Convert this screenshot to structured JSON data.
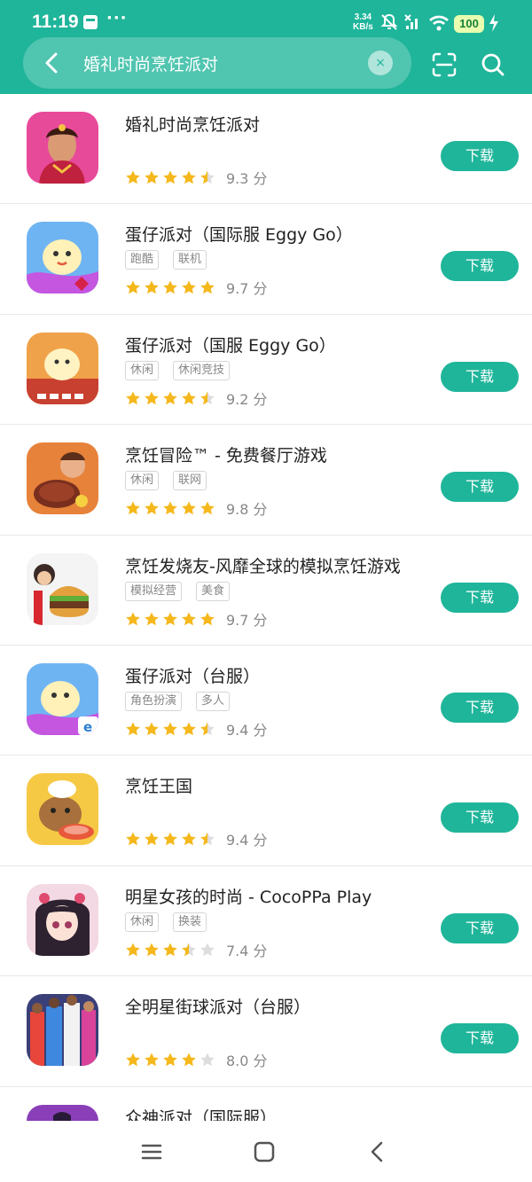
{
  "status_bar": {
    "time": "11:19",
    "net_speed_value": "3.34",
    "net_speed_unit": "KB/s",
    "battery": "100",
    "more": "···"
  },
  "search": {
    "query": "婚礼时尚烹饪派对",
    "clear_symbol": "×"
  },
  "colors": {
    "accent": "#1fb59a",
    "star": "#f5b81c",
    "star_empty": "#dddddd"
  },
  "apps": [
    {
      "name": "婚礼时尚烹饪派对",
      "tags": [],
      "stars": 4.5,
      "score": "9.3 分",
      "button": "下载",
      "icon": "bride-portrait-icon"
    },
    {
      "name": "蛋仔派对（国际服 Eggy Go）",
      "tags": [
        "跑酷",
        "联机"
      ],
      "stars": 5,
      "score": "9.7 分",
      "button": "下载",
      "icon": "eggy-party-icon"
    },
    {
      "name": "蛋仔派对（国服 Eggy Go）",
      "tags": [
        "休闲",
        "休闲竞技"
      ],
      "stars": 4.5,
      "score": "9.2 分",
      "button": "下载",
      "icon": "eggy-party-2026-icon"
    },
    {
      "name": "烹饪冒险™ - 免费餐厅游戏",
      "tags": [
        "休闲",
        "联网"
      ],
      "stars": 5,
      "score": "9.8 分",
      "button": "下载",
      "icon": "steak-chef-icon"
    },
    {
      "name": "烹饪发烧友-风靡全球的模拟烹饪游戏",
      "tags": [
        "模拟经营",
        "美食"
      ],
      "stars": 5,
      "score": "9.7 分",
      "button": "下载",
      "icon": "burger-chef-icon"
    },
    {
      "name": "蛋仔派对（台服）",
      "tags": [
        "角色扮演",
        "多人"
      ],
      "stars": 4.5,
      "score": "9.4 分",
      "button": "下载",
      "icon": "eggy-party-tw-icon"
    },
    {
      "name": "烹饪王国",
      "tags": [],
      "stars": 4.5,
      "score": "9.4 分",
      "button": "下载",
      "icon": "capybara-chef-icon"
    },
    {
      "name": "明星女孩的时尚 - CocoPPa Play",
      "tags": [
        "休闲",
        "换装"
      ],
      "stars": 3.5,
      "score": "7.4 分",
      "button": "下载",
      "icon": "anime-girl-icon"
    },
    {
      "name": "全明星街球派对（台服）",
      "tags": [],
      "stars": 4,
      "score": "8.0 分",
      "button": "下载",
      "icon": "basketball-players-icon"
    }
  ],
  "partial_app": {
    "name": "众神派对（国际服）"
  }
}
